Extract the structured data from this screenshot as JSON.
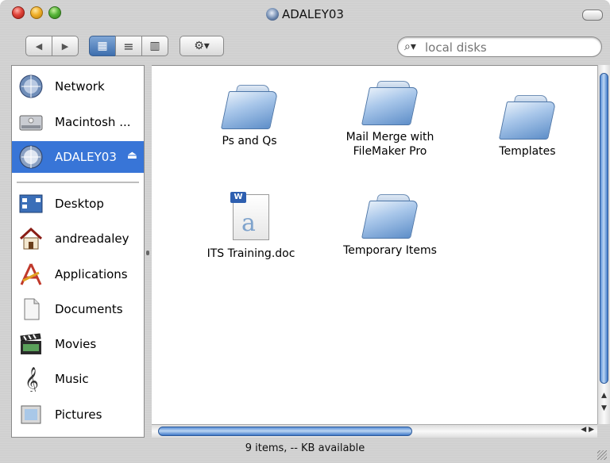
{
  "window": {
    "title": "ADALEY03"
  },
  "toolbar": {
    "back_glyph": "◀",
    "forward_glyph": "▶",
    "view_icon_glyph": "▦",
    "view_list_glyph": "≡",
    "view_column_glyph": "▥",
    "action_glyph": "⚙▾"
  },
  "search": {
    "placeholder": "local disks",
    "icon": "magnifier-icon"
  },
  "sidebar": {
    "items": [
      {
        "label": "Network",
        "icon": "network-globe-icon"
      },
      {
        "label": "Macintosh ...",
        "icon": "hard-disk-icon"
      },
      {
        "label": "ADALEY03",
        "icon": "network-volume-icon",
        "selected": true
      },
      {
        "label": "Desktop",
        "icon": "desktop-icon"
      },
      {
        "label": "andreadaley",
        "icon": "home-icon"
      },
      {
        "label": "Applications",
        "icon": "applications-icon"
      },
      {
        "label": "Documents",
        "icon": "documents-icon"
      },
      {
        "label": "Movies",
        "icon": "movies-clapper-icon"
      },
      {
        "label": "Music",
        "icon": "music-clef-icon"
      },
      {
        "label": "Pictures",
        "icon": "pictures-frame-icon"
      }
    ],
    "eject_glyph": "⏏"
  },
  "files": [
    {
      "name": "Ps and Qs",
      "type": "folder"
    },
    {
      "name": "Mail Merge with FileMaker Pro",
      "line1": "Mail Merge with",
      "line2": "FileMaker Pro",
      "type": "folder"
    },
    {
      "name": "Templates",
      "type": "folder"
    },
    {
      "name": "ITS Training.doc",
      "type": "document"
    },
    {
      "name": "Temporary Items",
      "type": "folder"
    }
  ],
  "status": {
    "text": "9 items, -- KB available"
  },
  "colors": {
    "selection": "#3875d7",
    "scroll_thumb": "#5a8fd6"
  }
}
